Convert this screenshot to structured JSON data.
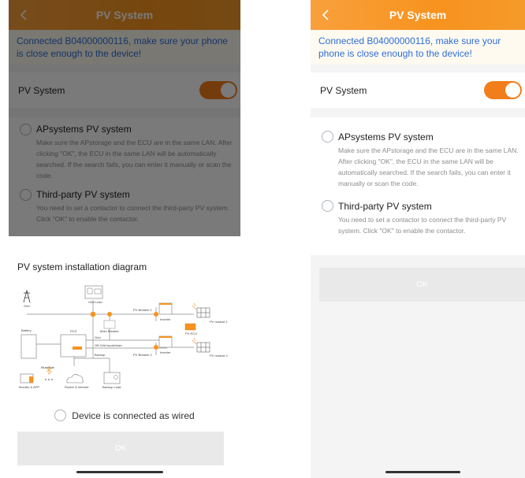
{
  "app": {
    "title": "PV System"
  },
  "banner": {
    "text": "Connected B04000000116, make sure your phone is close enough to the device!"
  },
  "pv_toggle": {
    "label": "PV System",
    "state": "on"
  },
  "options": [
    {
      "title": "APsystems PV system",
      "description": "Make sure the APstorage and the ECU are in the same LAN. After clicking \"OK\", the ECU in the same LAN will be automatically searched. If the search fails, you can enter it manually or scan the code."
    },
    {
      "title": "Third-party PV system",
      "description": "You need to set a contactor to connect the third-party PV system. Click \"OK\" to enable the contactor."
    }
  ],
  "ok_label": "OK",
  "sheet": {
    "title": "PV system installation diagram",
    "wired_label": "Device is connected as wired"
  },
  "diagram": {
    "labels": {
      "grid_load": "Grid Load",
      "grid": "Grid",
      "battery": "Battery",
      "pcs": "PCS",
      "main_breaker": "Main Breaker",
      "pv_breaker_1": "PV Breaker 1",
      "pv_breaker_2": "PV Breaker 2",
      "inverter": "Inverter",
      "pv_module_1": "PV module 1",
      "pv_module_2": "PV module 2",
      "pv_ecu": "PV ECU",
      "grid_line": "Grid",
      "off_grid": "Off-Grid input/chain",
      "backup": "Backup",
      "bluetooth": "Bluetooth",
      "monitor_app": "Monitor & APP",
      "router": "Router & Internet",
      "backup_load": "Backup Load"
    }
  },
  "colors": {
    "accent": "#f7931e",
    "link": "#2d6fd8"
  }
}
